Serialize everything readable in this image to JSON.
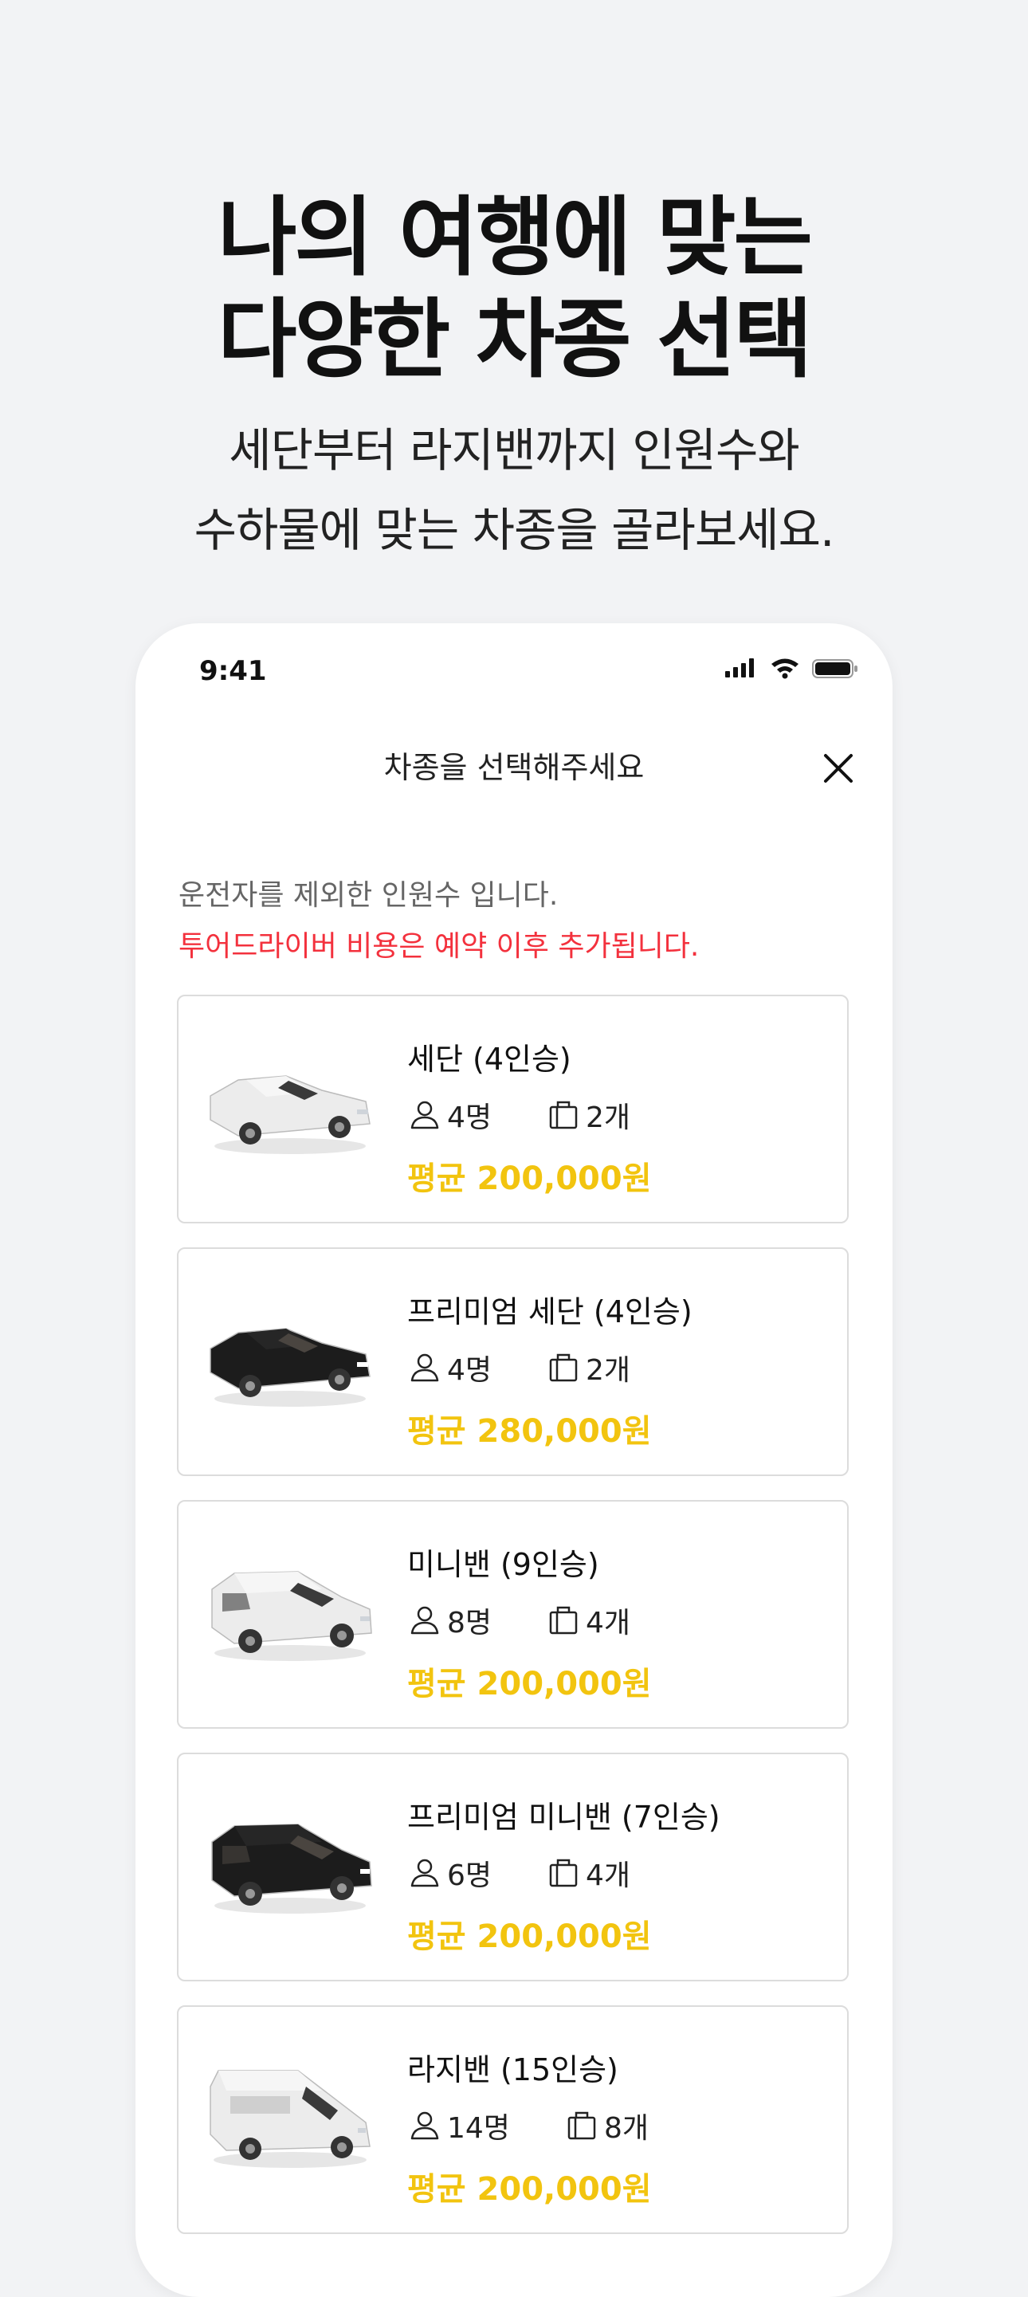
{
  "hero": {
    "title_line1": "나의 여행에 맞는",
    "title_line2": "다양한 차종 선택",
    "subtitle_line1": "세단부터 라지밴까지 인원수와",
    "subtitle_line2": "수하물에 맞는 차종을 골라보세요."
  },
  "status_bar": {
    "time": "9:41"
  },
  "modal": {
    "title": "차종을 선택해주세요",
    "notice": "운전자를 제외한 인원수 입니다.",
    "warning": "투어드라이버 비용은 예약 이후 추가됩니다.",
    "colors": {
      "price": "#f2c40f",
      "warning": "#f3313d"
    }
  },
  "vehicles": [
    {
      "name": "세단 (4인승)",
      "passengers": "4명",
      "luggage": "2개",
      "price": "평균 200,000원",
      "car_color": "white",
      "car_icon": "sedan-icon"
    },
    {
      "name": "프리미엄 세단 (4인승)",
      "passengers": "4명",
      "luggage": "2개",
      "price": "평균 280,000원",
      "car_color": "black",
      "car_icon": "sedan-icon"
    },
    {
      "name": "미니밴 (9인승)",
      "passengers": "8명",
      "luggage": "4개",
      "price": "평균 200,000원",
      "car_color": "white",
      "car_icon": "minivan-icon"
    },
    {
      "name": "프리미엄 미니밴 (7인승)",
      "passengers": "6명",
      "luggage": "4개",
      "price": "평균 200,000원",
      "car_color": "black",
      "car_icon": "minivan-icon"
    },
    {
      "name": "라지밴 (15인승)",
      "passengers": "14명",
      "luggage": "8개",
      "price": "평균 200,000원",
      "car_color": "white",
      "car_icon": "van-icon"
    }
  ]
}
